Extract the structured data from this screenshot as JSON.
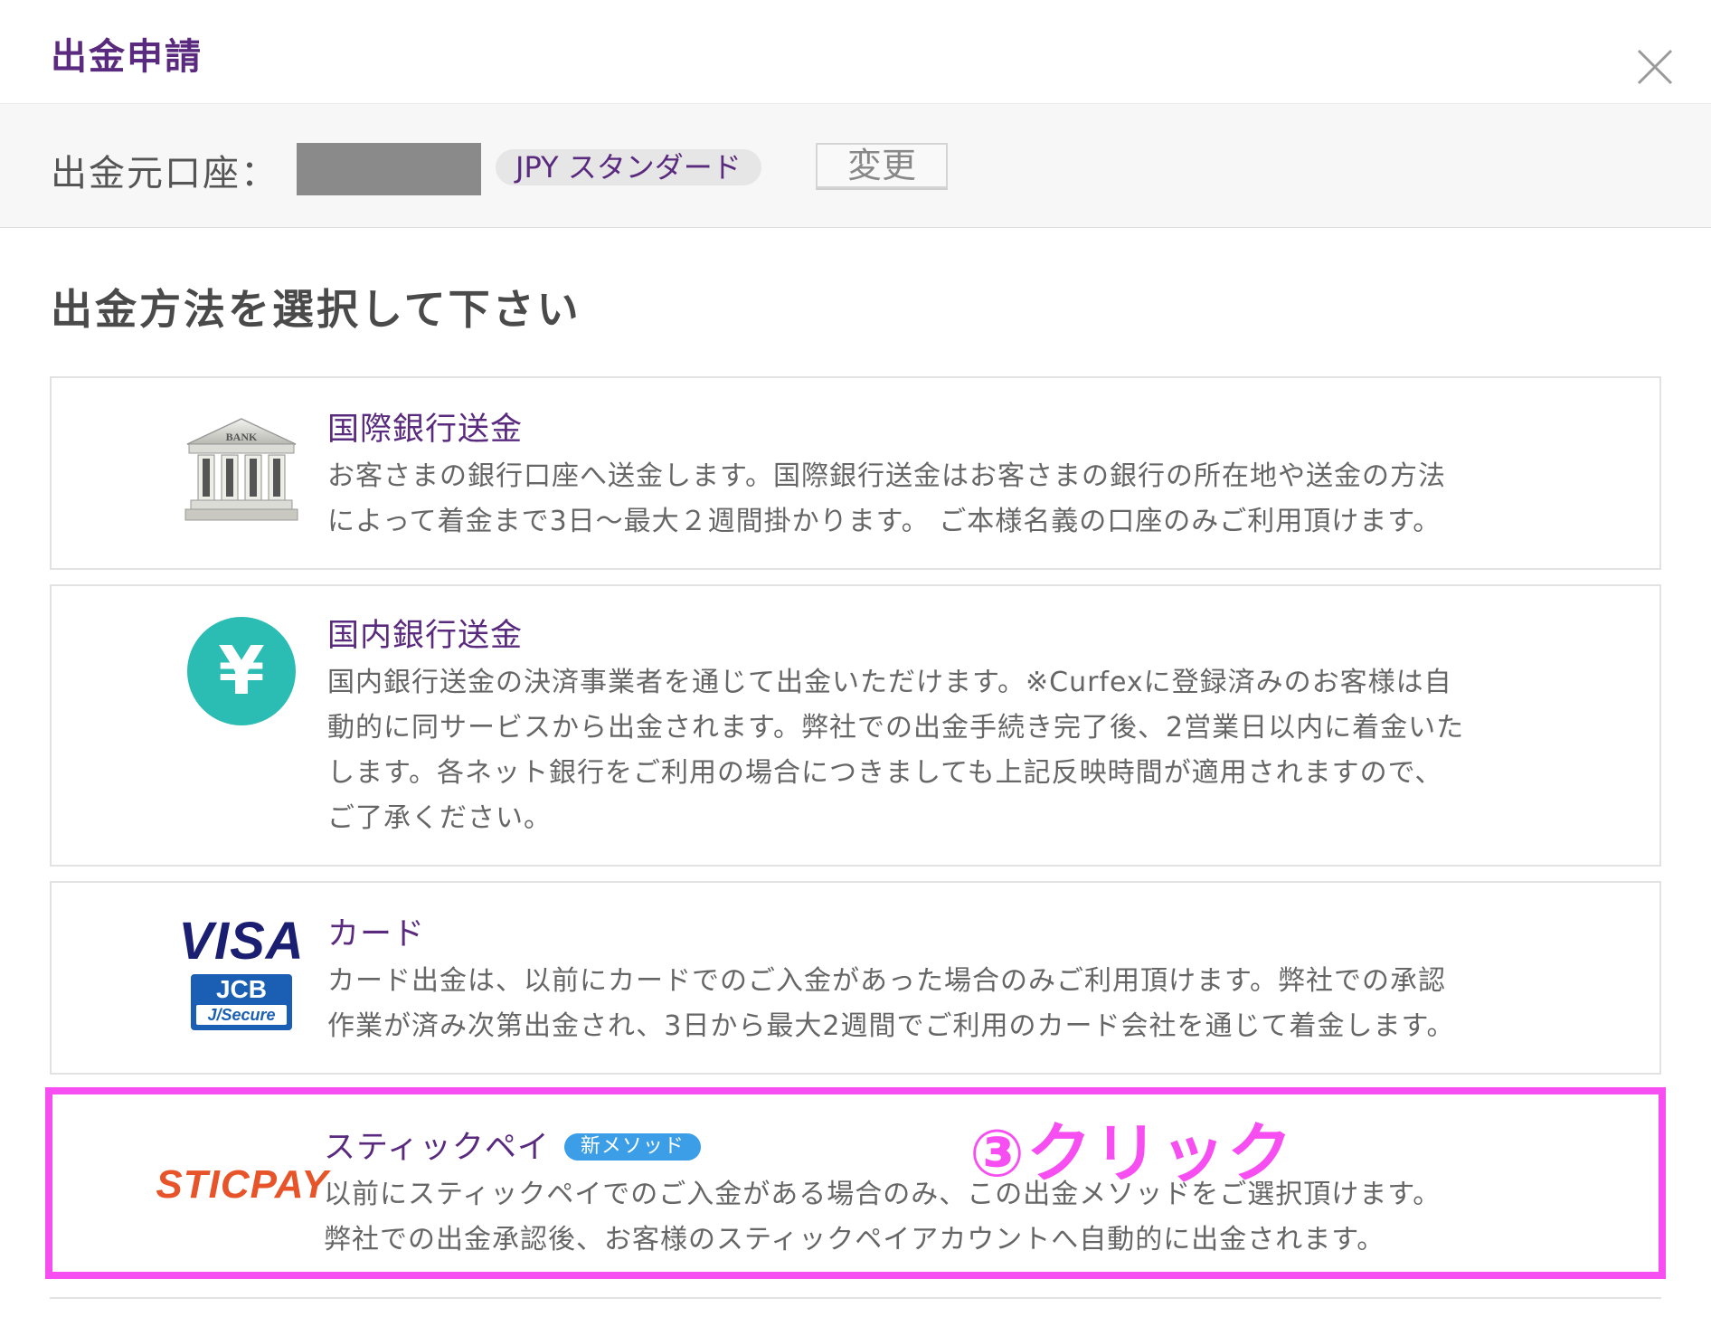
{
  "header": {
    "title": "出金申請",
    "close_icon": "close-icon"
  },
  "account": {
    "label": "出金元口座：",
    "tag": "JPY スタンダード",
    "change_label": "変更"
  },
  "section_title": "出金方法を選択して下さい",
  "methods": [
    {
      "name": "国際銀行送金",
      "icon": "bank-icon",
      "icon_text": "BANK",
      "desc": [
        "お客さまの銀行口座へ送金します。国際銀行送金はお客さまの銀行の所在地や送金の方法",
        "によって着金まで3日〜最大２週間掛かります。 ご本様名義の口座のみご利用頂けます。"
      ]
    },
    {
      "name": "国内銀行送金",
      "icon": "yen-icon",
      "icon_text": "¥",
      "desc": [
        "国内銀行送金の決済事業者を通じて出金いただけます。※Curfexに登録済みのお客様は自",
        "動的に同サービスから出金されます。弊社での出金手続き完了後、2営業日以内に着金いた",
        "します。各ネット銀行をご利用の場合につきましても上記反映時間が適用されますので、",
        "ご了承ください。"
      ]
    },
    {
      "name": "カード",
      "icon": "card-brands-icon",
      "visa_text": "VISA",
      "jcb_text": "JCB",
      "jsecure_text": "J/Secure",
      "desc": [
        "カード出金は、以前にカードでのご入金があった場合のみご利用頂けます。弊社での承認",
        "作業が済み次第出金され、3日から最大2週間でご利用のカード会社を通じて着金します。"
      ]
    },
    {
      "name": "スティックペイ",
      "icon": "sticpay-logo",
      "logo_text": "STICPAY",
      "badge": "新メソッド",
      "desc": [
        "以前にスティックペイでのご入金がある場合のみ、この出金メソッドをご選択頂けます。",
        "弊社での出金承認後、お客様のスティックペイアカウントへ自動的に出金されます。"
      ]
    }
  ],
  "annotation": "③クリック",
  "colors": {
    "accent": "#5a2a7e",
    "highlight": "#f74ef2",
    "badge": "#3b9ee6",
    "yen": "#2bbcb3",
    "sticpay": "#e8542a",
    "visa": "#1a1f71"
  }
}
